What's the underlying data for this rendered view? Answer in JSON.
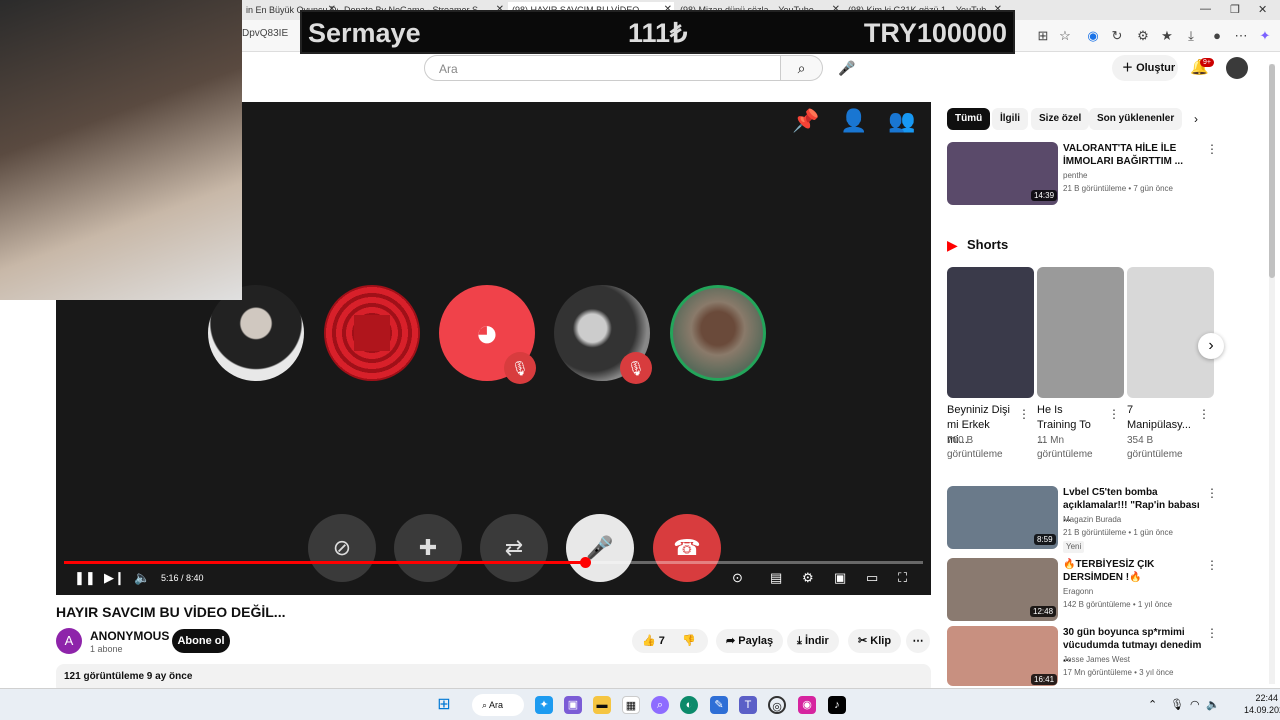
{
  "browser": {
    "tabs": [
      {
        "label": "in En Büyük Oyuncu Dev..."
      },
      {
        "label": "Donate By NoGame - Streamer S..."
      },
      {
        "label": "(98) HAYIR SAVCIM BU VİDEO..."
      },
      {
        "label": "(98) Mizan dünü sözla... YouTube"
      },
      {
        "label": "(98) Kim ki G31K gözü 1... YouTub"
      }
    ],
    "url": "DpvQ83IE"
  },
  "overlay": {
    "label": "Sermaye",
    "amount": "111₺",
    "target": "TRY100000"
  },
  "youtube": {
    "search_placeholder": "Ara",
    "create_label": "Oluştur",
    "notif_badge": "9+"
  },
  "player": {
    "time": "5:16 / 8:40",
    "progress": 0.607
  },
  "video": {
    "title": "HAYIR SAVCIM BU VİDEO DEĞİL...",
    "channel": "ANONYMOUS",
    "channel_initial": "A",
    "subscribers": "1 abone",
    "subscribe_label": "Abone ol",
    "likes": "7",
    "share_label": "Paylaş",
    "download_label": "İndir",
    "clip_label": "Klip",
    "views_date": "121 görüntüleme  9 ay önce"
  },
  "sidebar": {
    "chips": [
      "Tümü",
      "İlgili",
      "Size özel",
      "Son yüklenenler"
    ],
    "videos": [
      {
        "title": "VALORANT'TA HİLE İLE İMMOLARI BAĞIRTTIM ...",
        "channel": "penthe",
        "meta": "21 B görüntüleme • 7 gün önce",
        "duration": "14:39",
        "color": "#5a4a6a"
      },
      {
        "title": "Lvbel C5'ten bomba açıklamalar!!! \"Rap'in babası ...",
        "channel": "Magazin Burada",
        "meta": "21 B görüntüleme • 1 gün önce",
        "badge": "Yeni",
        "duration": "8:59",
        "color": "#6a7a8a"
      },
      {
        "title": "🔥TERBİYESİZ ÇIK DERSİMDEN !🔥",
        "channel": "Eragonn",
        "meta": "142 B görüntüleme • 1 yıl önce",
        "duration": "12:48",
        "color": "#8a7a70"
      },
      {
        "title": "30 gün boyunca sp*rmimi vücudumda tutmayı denedim ...",
        "channel": "Jesse James West",
        "meta": "17 Mn görüntüleme • 3 yıl önce",
        "duration": "16:41",
        "color": "#c89080"
      }
    ],
    "shorts_label": "Shorts",
    "shorts": [
      {
        "title": "Beyniniz Dişi mi Erkek mi...",
        "views": "700 B görüntüleme",
        "color": "#3a3a4a"
      },
      {
        "title": "He Is Training To ...",
        "views": "11 Mn görüntüleme",
        "color": "#9a9a9a"
      },
      {
        "title": "7 Manipülasy...",
        "views": "354 B görüntüleme",
        "color": "#d8d8d8"
      }
    ]
  },
  "taskbar": {
    "search_label": "Ara",
    "time": "22:44",
    "date": "14.09.2025"
  }
}
